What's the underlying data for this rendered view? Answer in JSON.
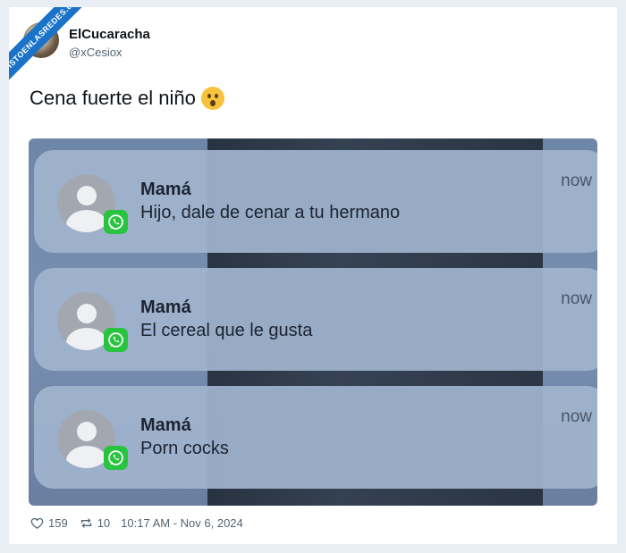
{
  "watermark": "VISTOENLASREDES.com",
  "author": {
    "name": "ElCucaracha",
    "handle": "@xCesiox"
  },
  "tweet": {
    "text": "Cena fuerte el niño",
    "emoji": "astonished-face"
  },
  "notifications": [
    {
      "title": "Mamá",
      "message": "Hijo, dale de cenar a tu hermano",
      "time": "now",
      "app": "whatsapp-icon"
    },
    {
      "title": "Mamá",
      "message": "El cereal que le gusta",
      "time": "now",
      "app": "whatsapp-icon"
    },
    {
      "title": "Mamá",
      "message": "Porn cocks",
      "time": "now",
      "app": "whatsapp-icon"
    }
  ],
  "stats": {
    "likes": "159",
    "retweets": "10",
    "timestamp": "10:17 AM - Nov 6, 2024"
  },
  "colors": {
    "ribbon": "#1a73c8",
    "whatsapp": "#28c43f",
    "notification_bg": "#a0b4cd"
  }
}
